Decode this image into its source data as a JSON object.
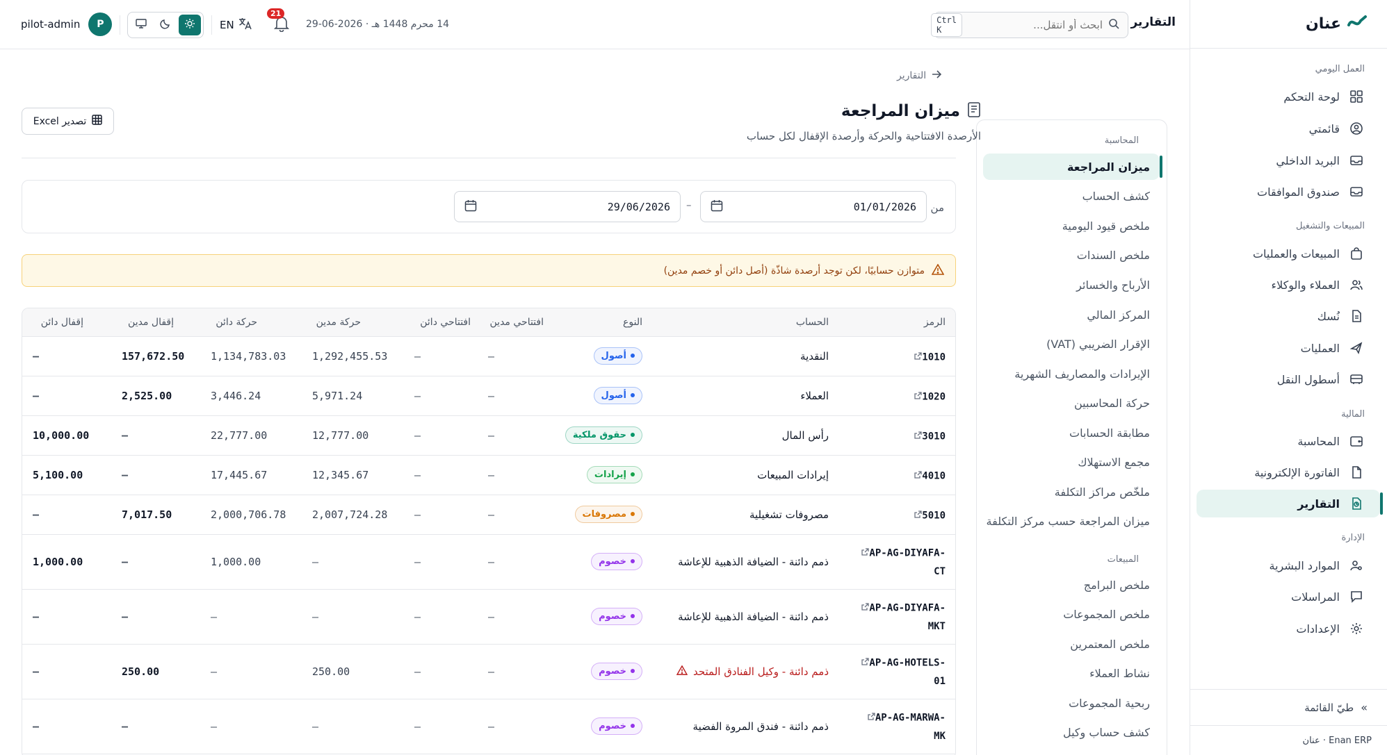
{
  "app": {
    "brand": "عنان",
    "version": "Enan ERP · عنان"
  },
  "colors": {
    "accent": "#0f766e",
    "warning": "#dc2626"
  },
  "sidebar": {
    "groups": [
      "العمل اليومي",
      "المبيعات والتشغيل",
      "المالية",
      "الإدارة"
    ],
    "items": [
      {
        "label": "لوحة التحكم",
        "icon": "dashboard-icon"
      },
      {
        "label": "قائمتي",
        "icon": "user-circle-icon"
      },
      {
        "label": "البريد الداخلي",
        "icon": "inbox-icon"
      },
      {
        "label": "صندوق الموافقات",
        "icon": "inbox-icon"
      },
      {
        "label": "المبيعات والعمليات",
        "icon": "bag-icon"
      },
      {
        "label": "العملاء والوكلاء",
        "icon": "users-icon"
      },
      {
        "label": "نُسك",
        "icon": "document-icon"
      },
      {
        "label": "العمليات",
        "icon": "plane-icon"
      },
      {
        "label": "أسطول النقل",
        "icon": "bus-icon"
      },
      {
        "label": "المحاسبة",
        "icon": "wallet-icon"
      },
      {
        "label": "الفاتورة الإلكترونية",
        "icon": "file-icon"
      },
      {
        "label": "التقارير",
        "icon": "report-icon"
      },
      {
        "label": "الموارد البشرية",
        "icon": "person-gear-icon"
      },
      {
        "label": "المراسلات",
        "icon": "message-icon"
      },
      {
        "label": "الإعدادات",
        "icon": "gear-icon"
      }
    ],
    "collapse": "طيّ القائمة"
  },
  "topbar": {
    "title": "التقارير",
    "search_placeholder": "ابحث أو انتقل...",
    "search_shortcut": "Ctrl K",
    "date": "14 محرم 1448 هـ · 2026-06-29",
    "notifications": "21",
    "lang": "EN",
    "user": "pilot-admin",
    "avatar": "P"
  },
  "report_nav": {
    "group_accounting": "المحاسبة",
    "accounting_items": [
      "ميزان المراجعة",
      "كشف الحساب",
      "ملخص قيود اليومية",
      "ملخص السندات",
      "الأرباح والخسائر",
      "المركز المالي",
      "الإقرار الضريبي (VAT)",
      "الإيرادات والمصاريف الشهرية",
      "حركة المحاسبين",
      "مطابقة الحسابات",
      "مجمع الاستهلاك",
      "ملخّص مراكز التكلفة",
      "ميزان المراجعة حسب مركز التكلفة"
    ],
    "group_sales": "المبيعات",
    "sales_items": [
      "ملخص البرامج",
      "ملخص المجموعات",
      "ملخص المعتمرين",
      "نشاط العملاء",
      "ربحية المجموعات",
      "كشف حساب وكيل"
    ]
  },
  "page": {
    "breadcrumb": "التقارير",
    "title": "ميزان المراجعة",
    "subtitle": "الأرصدة الافتتاحية والحركة وأرصدة الإقفال لكل حساب",
    "export_label": "تصدير Excel",
    "from_label": "من",
    "date_from": "01/01/2026",
    "date_to": "29/06/2026",
    "range_dash": "–",
    "alert": "متوازن حسابيًا، لكن توجد أرصدة شاذّة (أصل دائن أو خصم مدين)"
  },
  "table": {
    "headers": {
      "code": "الرمز",
      "account": "الحساب",
      "type": "النوع",
      "open_debit": "افتتاحي مدين",
      "open_credit": "افتتاحي دائن",
      "move_debit": "حركة مدين",
      "move_credit": "حركة دائن",
      "close_debit": "إقفال مدين",
      "close_credit": "إقفال دائن"
    },
    "rows": [
      {
        "code": "1010",
        "account": "النقدية",
        "type": "أصول",
        "type_color": "#2563eb",
        "open_debit": "—",
        "open_credit": "—",
        "move_debit": "1,292,455.53",
        "move_credit": "1,134,783.03",
        "close_debit": "157,672.50",
        "close_credit": "—"
      },
      {
        "code": "1020",
        "account": "العملاء",
        "type": "أصول",
        "type_color": "#2563eb",
        "open_debit": "—",
        "open_credit": "—",
        "move_debit": "5,971.24",
        "move_credit": "3,446.24",
        "close_debit": "2,525.00",
        "close_credit": "—"
      },
      {
        "code": "3010",
        "account": "رأس المال",
        "type": "حقوق ملكية",
        "type_color": "#059669",
        "open_debit": "—",
        "open_credit": "—",
        "move_debit": "12,777.00",
        "move_credit": "22,777.00",
        "close_debit": "—",
        "close_credit": "10,000.00"
      },
      {
        "code": "4010",
        "account": "إيرادات المبيعات",
        "type": "إيرادات",
        "type_color": "#16a34a",
        "open_debit": "—",
        "open_credit": "—",
        "move_debit": "12,345.67",
        "move_credit": "17,445.67",
        "close_debit": "—",
        "close_credit": "5,100.00"
      },
      {
        "code": "5010",
        "account": "مصروفات تشغيلية",
        "type": "مصروفات",
        "type_color": "#d97706",
        "open_debit": "—",
        "open_credit": "—",
        "move_debit": "2,007,724.28",
        "move_credit": "2,000,706.78",
        "close_debit": "7,017.50",
        "close_credit": "—"
      },
      {
        "code_lines": [
          "AP-AG-DIYAFA-",
          "CT"
        ],
        "account": "ذمم دائنة - الضيافة الذهبية للإعاشة",
        "type": "خصوم",
        "type_color": "#9333ea",
        "open_debit": "—",
        "open_credit": "—",
        "move_debit": "—",
        "move_credit": "1,000.00",
        "close_debit": "—",
        "close_credit": "1,000.00"
      },
      {
        "code_lines": [
          "AP-AG-DIYAFA-",
          "MKT"
        ],
        "account": "ذمم دائنة - الضيافة الذهبية للإعاشة",
        "type": "خصوم",
        "type_color": "#9333ea",
        "open_debit": "—",
        "open_credit": "—",
        "move_debit": "—",
        "move_credit": "—",
        "close_debit": "—",
        "close_credit": "—"
      },
      {
        "code_lines": [
          "AP-AG-HOTELS-",
          "01"
        ],
        "account": "ذمم دائنة - وكيل الفنادق المتحد",
        "warn": true,
        "type": "خصوم",
        "type_color": "#9333ea",
        "open_debit": "—",
        "open_credit": "—",
        "move_debit": "250.00",
        "move_credit": "—",
        "close_debit": "250.00",
        "close_credit": "—"
      },
      {
        "code_lines": [
          "AP-AG-MARWA-",
          "MK"
        ],
        "account": "ذمم دائنة - فندق المروة الفضية",
        "type": "خصوم",
        "type_color": "#9333ea",
        "open_debit": "—",
        "open_credit": "—",
        "move_debit": "—",
        "move_credit": "—",
        "close_debit": "—",
        "close_credit": "—"
      }
    ]
  }
}
